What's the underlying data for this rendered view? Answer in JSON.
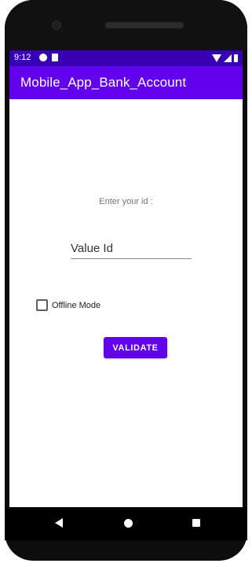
{
  "status_bar": {
    "time": "9:12",
    "icons": [
      "g-icon",
      "sd-card-icon",
      "wifi-icon",
      "signal-icon",
      "battery-icon"
    ]
  },
  "app_bar": {
    "title": "Mobile_App_Bank_Account",
    "color": "#6200ee"
  },
  "form": {
    "prompt": "Enter your id :",
    "id_input": {
      "placeholder": "Value Id",
      "value": ""
    },
    "offline_checkbox": {
      "label": "Offline Mode",
      "checked": false
    },
    "validate_button": {
      "label": "VALIDATE",
      "color": "#6200ee"
    }
  },
  "nav_bar": {
    "icons": [
      "back-icon",
      "home-icon",
      "recents-icon"
    ]
  }
}
